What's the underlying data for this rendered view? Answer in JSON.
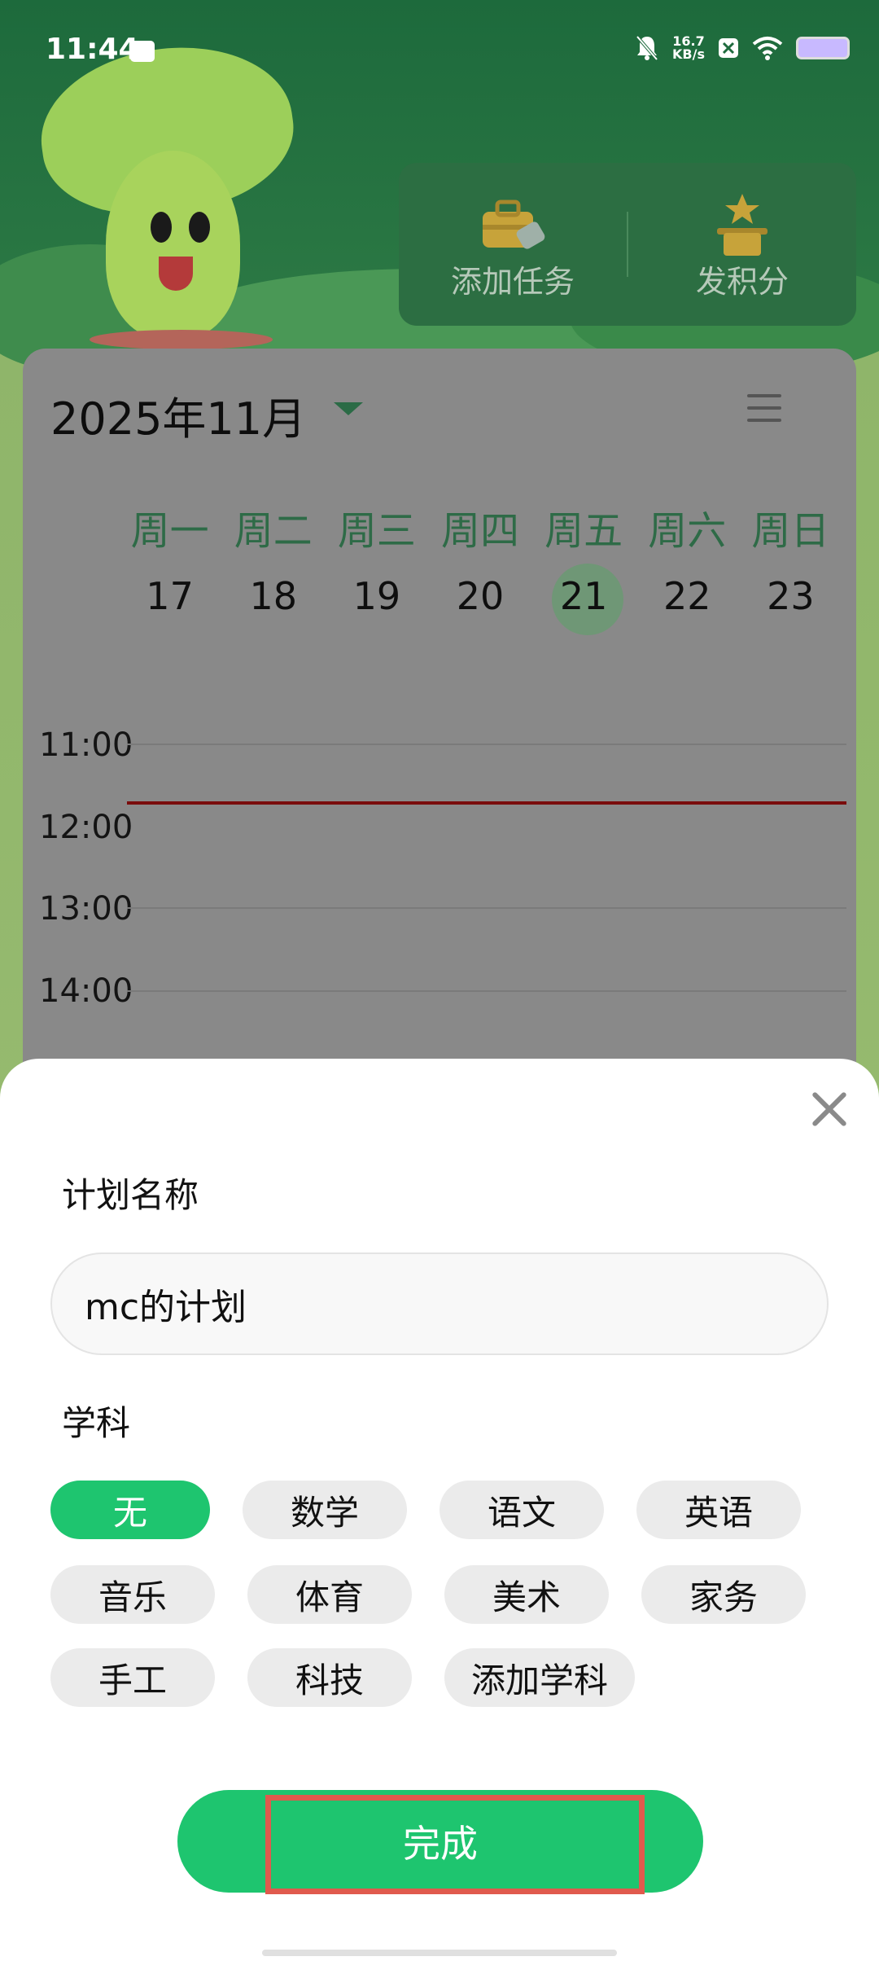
{
  "status_bar": {
    "time": "11:44",
    "speed_value": "16.7",
    "speed_unit": "KB/s"
  },
  "header_actions": {
    "add_task_label": "添加任务",
    "give_points_label": "发积分"
  },
  "calendar": {
    "month_title": "2025年11月",
    "weekdays": [
      "周一",
      "周二",
      "周三",
      "周四",
      "周五",
      "周六",
      "周日"
    ],
    "dates": [
      "17",
      "18",
      "19",
      "20",
      "21",
      "22",
      "23"
    ],
    "selected_date": "21",
    "time_labels": [
      "11:00",
      "12:00",
      "13:00",
      "14:00"
    ]
  },
  "sheet": {
    "plan_name_label": "计划名称",
    "plan_name_value": "mc的计划",
    "subject_label": "学科",
    "subjects": [
      "无",
      "数学",
      "语文",
      "英语",
      "音乐",
      "体育",
      "美术",
      "家务",
      "手工",
      "科技",
      "添加学科"
    ],
    "selected_subject": "无",
    "done_label": "完成"
  },
  "colors": {
    "accent_green": "#1ec56f",
    "highlight_red": "#e05a4d"
  }
}
